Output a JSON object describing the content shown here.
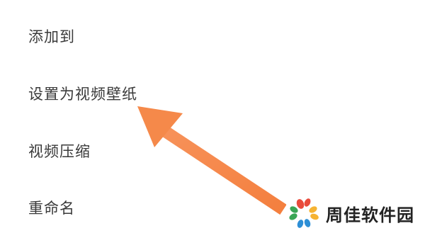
{
  "menu": {
    "items": [
      {
        "label": "添加到"
      },
      {
        "label": "设置为视频壁纸"
      },
      {
        "label": "视频压缩"
      },
      {
        "label": "重命名"
      }
    ]
  },
  "annotation": {
    "arrow_color": "#f5894a",
    "points_to": "设置为视频壁纸"
  },
  "watermark": {
    "text": "周佳软件园",
    "logo_colors": [
      "#e94b3c",
      "#f6b332",
      "#3aa655",
      "#2d8fd6"
    ]
  }
}
